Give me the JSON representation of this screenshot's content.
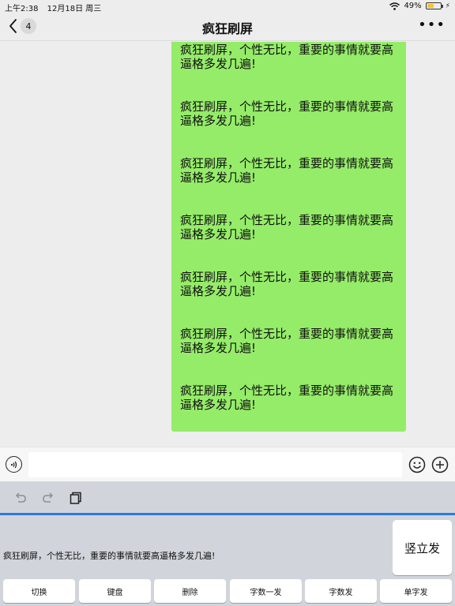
{
  "status_bar": {
    "time": "上午2:38",
    "date": "12月18日 周三",
    "battery_percent_text": "49%",
    "battery_level": 0.49
  },
  "nav": {
    "back_badge": "4",
    "title": "疯狂刷屏"
  },
  "chat": {
    "messages": [
      {
        "line1": "疯狂刷屏，个性无比，重要的事情就要高",
        "line2": "逼格多发几遍!"
      },
      {
        "line1": "疯狂刷屏，个性无比，重要的事情就要高",
        "line2": "逼格多发几遍!"
      },
      {
        "line1": "疯狂刷屏，个性无比，重要的事情就要高",
        "line2": "逼格多发几遍!"
      },
      {
        "line1": "疯狂刷屏，个性无比，重要的事情就要高",
        "line2": "逼格多发几遍!"
      },
      {
        "line1": "疯狂刷屏，个性无比，重要的事情就要高",
        "line2": "逼格多发几遍!"
      },
      {
        "line1": "疯狂刷屏，个性无比，重要的事情就要高",
        "line2": "逼格多发几遍!"
      },
      {
        "line1": "疯狂刷屏，个性无比，重要的事情就要高",
        "line2": "逼格多发几遍!"
      }
    ]
  },
  "input": {
    "value": ""
  },
  "keyboard": {
    "preview_text": "疯狂刷屏，个性无比，重要的事情就要高逼格多发几遍!",
    "send_label": "竖立发",
    "keys": [
      "切换",
      "键盘",
      "删除",
      "字数一发",
      "字数发",
      "单字发"
    ]
  },
  "colors": {
    "bubble": "#95ec69",
    "accent_line": "#2a7ae2",
    "keyboard_bg": "#d1d5db"
  },
  "icons": {
    "back": "chevron-left-icon",
    "more": "more-dots-icon",
    "voice": "voice-icon",
    "emoji": "emoji-icon",
    "plus": "plus-circle-icon",
    "undo": "undo-icon",
    "redo": "redo-icon",
    "paste": "clipboard-icon",
    "wifi": "wifi-icon",
    "battery": "battery-icon"
  }
}
